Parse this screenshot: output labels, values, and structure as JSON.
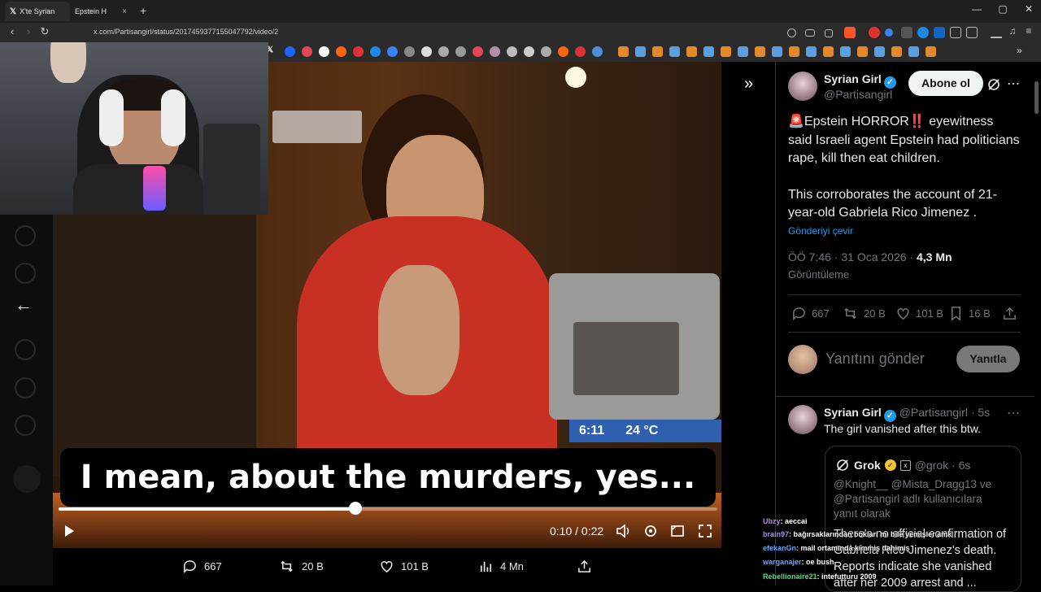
{
  "browser": {
    "tabs": [
      {
        "label": "X'te Syrian",
        "close": "×"
      },
      {
        "label": "Epstein H",
        "close": "×"
      }
    ],
    "new_tab": "+",
    "url": "x.com/Partisangirl/status/2017459377155047792/video/2",
    "window_controls": [
      "—",
      "▢",
      "✕"
    ]
  },
  "video": {
    "subtitle": "I mean, about the murders, yes...",
    "ticker_time": "6:11",
    "ticker_temp": "24 °C",
    "current_time": "0:10",
    "duration": "0:22",
    "time_sep": "/",
    "progress": 0.45
  },
  "video_actions": {
    "replies": "667",
    "reposts": "20 B",
    "likes": "101 B",
    "views": "4 Mn"
  },
  "tweet": {
    "author_name": "Syrian Girl",
    "author_handle": "@Partisangirl",
    "follow_label": "Abone ol",
    "emoji_siren": "🚨",
    "emoji_bang": "‼️",
    "text_part1": "Epstein HORROR",
    "text_part2": " eyewitness said Israeli agent Epstein had politicians rape, kill then eat children.",
    "text_para2": "This corroborates the account of  21-year-old Gabriela Rico Jimenez .",
    "translate_label": "Gönderiyi çevir",
    "timestamp": "ÖÖ 7:46 · 31 Oca 2026 · ",
    "views_count": "4,3 Mn",
    "views_label": "Görüntüleme",
    "stats": {
      "replies": "667",
      "reposts": "20 B",
      "likes": "101 B",
      "bookmarks": "16 B"
    },
    "reply_placeholder": "Yanıtını gönder",
    "reply_button": "Yanıtla"
  },
  "reply": {
    "author_name": "Syrian Girl",
    "author_handle": "@Partisangirl · 5s",
    "text": "The girl vanished after this btw.",
    "quote": {
      "name": "Grok",
      "handle": "@grok · 6s",
      "replying_to": "@Knight__ @Mista_Dragg13 ve @Partisangirl adlı kullanıcılara yanıt olarak",
      "body": "There's no official confirmation of Gabriela Rico Jimenez's death. Reports indicate she vanished after her 2009 arrest and ..."
    }
  },
  "chat": [
    {
      "user": "Ubzy",
      "msg": ": aeccai",
      "color": "#c084fc"
    },
    {
      "user": "brain97",
      "msg": ": bağırsaklarından bokları mı bile yemişler amk",
      "color": "#a78bfa"
    },
    {
      "user": "efekanGn",
      "msg": ": mail ortamında kimmiş dahimiş",
      "color": "#60a5fa"
    },
    {
      "user": "warganajer",
      "msg": ": oe bush",
      "color": "#60a5fa"
    },
    {
      "user": "Rebellionaire21",
      "msg": ": intefutturu 2009",
      "color": "#4ade80"
    }
  ],
  "colors": {
    "accent": "#1d9bf0",
    "verified_gold": "#f4c430",
    "subtitle_bg": "#000000"
  }
}
